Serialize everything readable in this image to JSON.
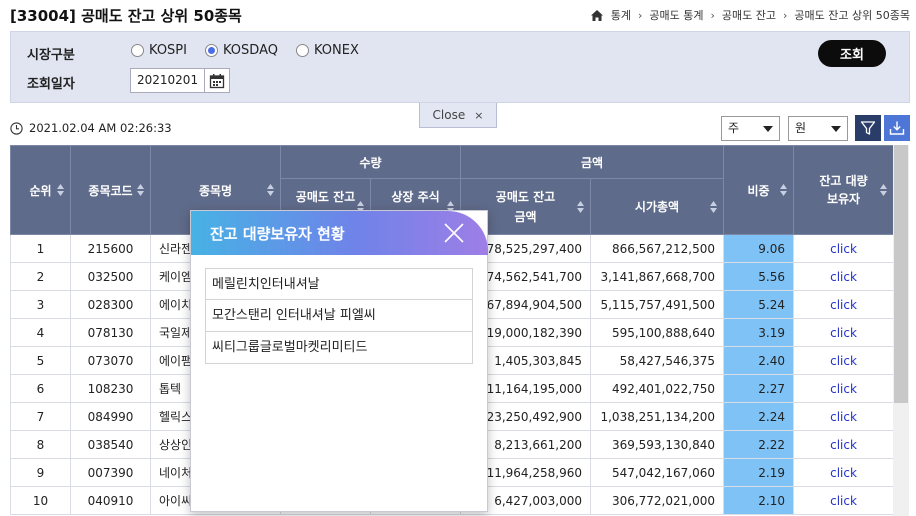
{
  "header": {
    "title": "[33004] 공매도 잔고 상위 50종목",
    "breadcrumb": [
      "통계",
      "공매도 통계",
      "공매도 잔고",
      "공매도 잔고 상위 50종목"
    ]
  },
  "search": {
    "market_label": "시장구분",
    "markets": [
      "KOSPI",
      "KOSDAQ",
      "KONEX"
    ],
    "selected_market": "KOSDAQ",
    "date_label": "조회일자",
    "date_value": "20210201",
    "search_button": "조회"
  },
  "close_tab": {
    "label": "Close",
    "x": "×"
  },
  "timestamp": "2021.02.04 AM 02:26:33",
  "toolbar": {
    "unit_share": "주",
    "unit_currency": "원"
  },
  "table": {
    "headers": {
      "rank": "순위",
      "code": "종목코드",
      "name": "종목명",
      "qty_group": "수량",
      "qty_short": "공매도 잔고수량",
      "qty_listed": "상장 주식수",
      "amt_group": "금액",
      "amt_short": "공매도 잔고금액",
      "amt_market": "시가총액",
      "ratio": "비중",
      "holder": "잔고 대량보유자"
    },
    "rows": [
      {
        "rank": "1",
        "code": "215600",
        "name": "신라젠",
        "short_amt": "78,525,297,400",
        "market_cap": "866,567,212,500",
        "ratio": "9.06",
        "holder": "click"
      },
      {
        "rank": "2",
        "code": "032500",
        "name": "케이엠",
        "short_amt": "174,562,541,700",
        "market_cap": "3,141,867,668,700",
        "ratio": "5.56",
        "holder": "click"
      },
      {
        "rank": "3",
        "code": "028300",
        "name": "에이치",
        "short_amt": "267,894,904,500",
        "market_cap": "5,115,757,491,500",
        "ratio": "5.24",
        "holder": "click"
      },
      {
        "rank": "4",
        "code": "078130",
        "name": "국일제",
        "short_amt": "19,000,182,390",
        "market_cap": "595,100,888,640",
        "ratio": "3.19",
        "holder": "click"
      },
      {
        "rank": "5",
        "code": "073070",
        "name": "에이팸",
        "short_amt": "1,405,303,845",
        "market_cap": "58,427,546,375",
        "ratio": "2.40",
        "holder": "click"
      },
      {
        "rank": "6",
        "code": "108230",
        "name": "톱텍",
        "short_amt": "11,164,195,000",
        "market_cap": "492,401,022,750",
        "ratio": "2.27",
        "holder": "click"
      },
      {
        "rank": "7",
        "code": "084990",
        "name": "헬릭스",
        "short_amt": "23,250,492,900",
        "market_cap": "1,038,251,134,200",
        "ratio": "2.24",
        "holder": "click"
      },
      {
        "rank": "8",
        "code": "038540",
        "name": "상상인",
        "short_amt": "8,213,661,200",
        "market_cap": "369,593,130,840",
        "ratio": "2.22",
        "holder": "click"
      },
      {
        "rank": "9",
        "code": "007390",
        "name": "네이처",
        "short_amt": "11,964,258,960",
        "market_cap": "547,042,167,060",
        "ratio": "2.19",
        "holder": "click"
      },
      {
        "rank": "10",
        "code": "040910",
        "name": "아이씨",
        "short_amt": "6,427,003,000",
        "market_cap": "306,772,021,000",
        "ratio": "2.10",
        "holder": "click"
      }
    ]
  },
  "popup": {
    "title": "잔고 대량보유자 현황",
    "holders": [
      "메릴린치인터내셔날",
      "모간스탠리 인터내셔날 피엘씨",
      "씨티그룹글로벌마켓리미티드"
    ]
  }
}
